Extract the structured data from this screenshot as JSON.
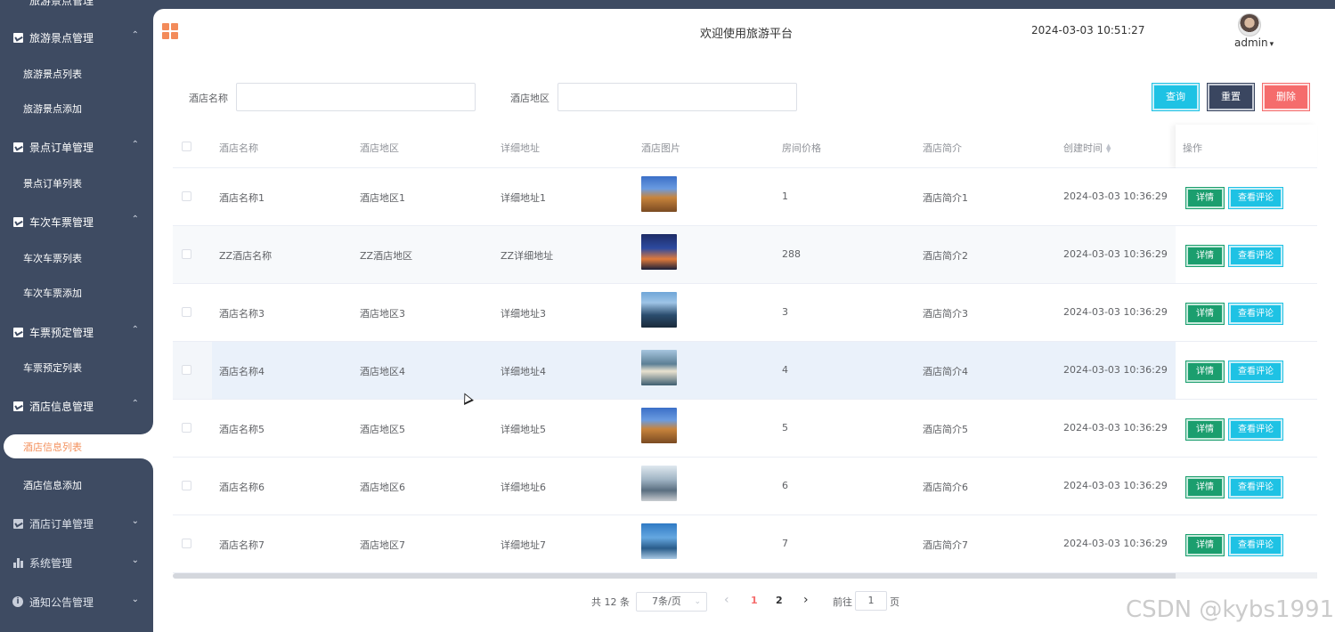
{
  "sidebar": {
    "top_partial_label": "旅游景点管理",
    "groups": [
      {
        "label": "旅游景点管理",
        "chevron": "⌃",
        "items": [
          "旅游景点列表",
          "旅游景点添加"
        ]
      },
      {
        "label": "景点订单管理",
        "chevron": "⌃",
        "items": [
          "景点订单列表"
        ]
      },
      {
        "label": "车次车票管理",
        "chevron": "⌃",
        "items": [
          "车次车票列表",
          "车次车票添加"
        ]
      },
      {
        "label": "车票预定管理",
        "chevron": "⌃",
        "items": [
          "车票预定列表"
        ]
      },
      {
        "label": "酒店信息管理",
        "chevron": "⌃",
        "items": [
          "酒店信息列表",
          "酒店信息添加"
        ]
      },
      {
        "label": "酒店订单管理",
        "chevron": "⌄"
      },
      {
        "label": "系统管理",
        "chevron": "⌄"
      },
      {
        "label": "通知公告管理",
        "chevron": "⌄"
      }
    ],
    "active_item": "酒店信息列表"
  },
  "header": {
    "welcome": "欢迎使用旅游平台",
    "datetime": "2024-03-03 10:51:27",
    "username": "admin",
    "user_caret": "▾"
  },
  "search": {
    "hotel_name_label": "酒店名称",
    "hotel_name_value": "",
    "hotel_region_label": "酒店地区",
    "hotel_region_value": "",
    "query_button": "查询",
    "reset_button": "重置",
    "delete_button": "删除"
  },
  "table": {
    "columns": [
      "酒店名称",
      "酒店地区",
      "详细地址",
      "酒店图片",
      "房间价格",
      "酒店简介",
      "创建时间",
      "操作"
    ],
    "rows": [
      {
        "name": "酒店名称1",
        "region": "酒店地区1",
        "address": "详细地址1",
        "price": "1",
        "intro": "酒店简介1",
        "created": "2024-03-03 10:36:29"
      },
      {
        "name": "ZZ酒店名称",
        "region": "ZZ酒店地区",
        "address": "ZZ详细地址",
        "price": "288",
        "intro": "酒店简介2",
        "created": "2024-03-03 10:36:29"
      },
      {
        "name": "酒店名称3",
        "region": "酒店地区3",
        "address": "详细地址3",
        "price": "3",
        "intro": "酒店简介3",
        "created": "2024-03-03 10:36:29"
      },
      {
        "name": "酒店名称4",
        "region": "酒店地区4",
        "address": "详细地址4",
        "price": "4",
        "intro": "酒店简介4",
        "created": "2024-03-03 10:36:29"
      },
      {
        "name": "酒店名称5",
        "region": "酒店地区5",
        "address": "详细地址5",
        "price": "5",
        "intro": "酒店简介5",
        "created": "2024-03-03 10:36:29"
      },
      {
        "name": "酒店名称6",
        "region": "酒店地区6",
        "address": "详细地址6",
        "price": "6",
        "intro": "酒店简介6",
        "created": "2024-03-03 10:36:29"
      },
      {
        "name": "酒店名称7",
        "region": "酒店地区7",
        "address": "详细地址7",
        "price": "7",
        "intro": "酒店简介7",
        "created": "2024-03-03 10:36:29"
      }
    ],
    "detail_button": "详情",
    "review_button": "查看评论"
  },
  "pagination": {
    "total": "共 12 条",
    "page_size": "7条/页",
    "prev": "‹",
    "pages": [
      "1",
      "2"
    ],
    "current_page": "1",
    "next": "›",
    "goto_label": "前往",
    "goto_value": "1",
    "page_suffix": "页"
  },
  "watermark": "CSDN @kybs1991",
  "colors": {
    "sidebar_bg": "#3e4b62",
    "accent_orange": "#f3915d",
    "query_cyan": "#1ec2e4",
    "reset_navy": "#3a4660",
    "delete_red": "#f56c6c",
    "detail_green": "#1b9e6e",
    "active_page": "#f56c6c"
  }
}
